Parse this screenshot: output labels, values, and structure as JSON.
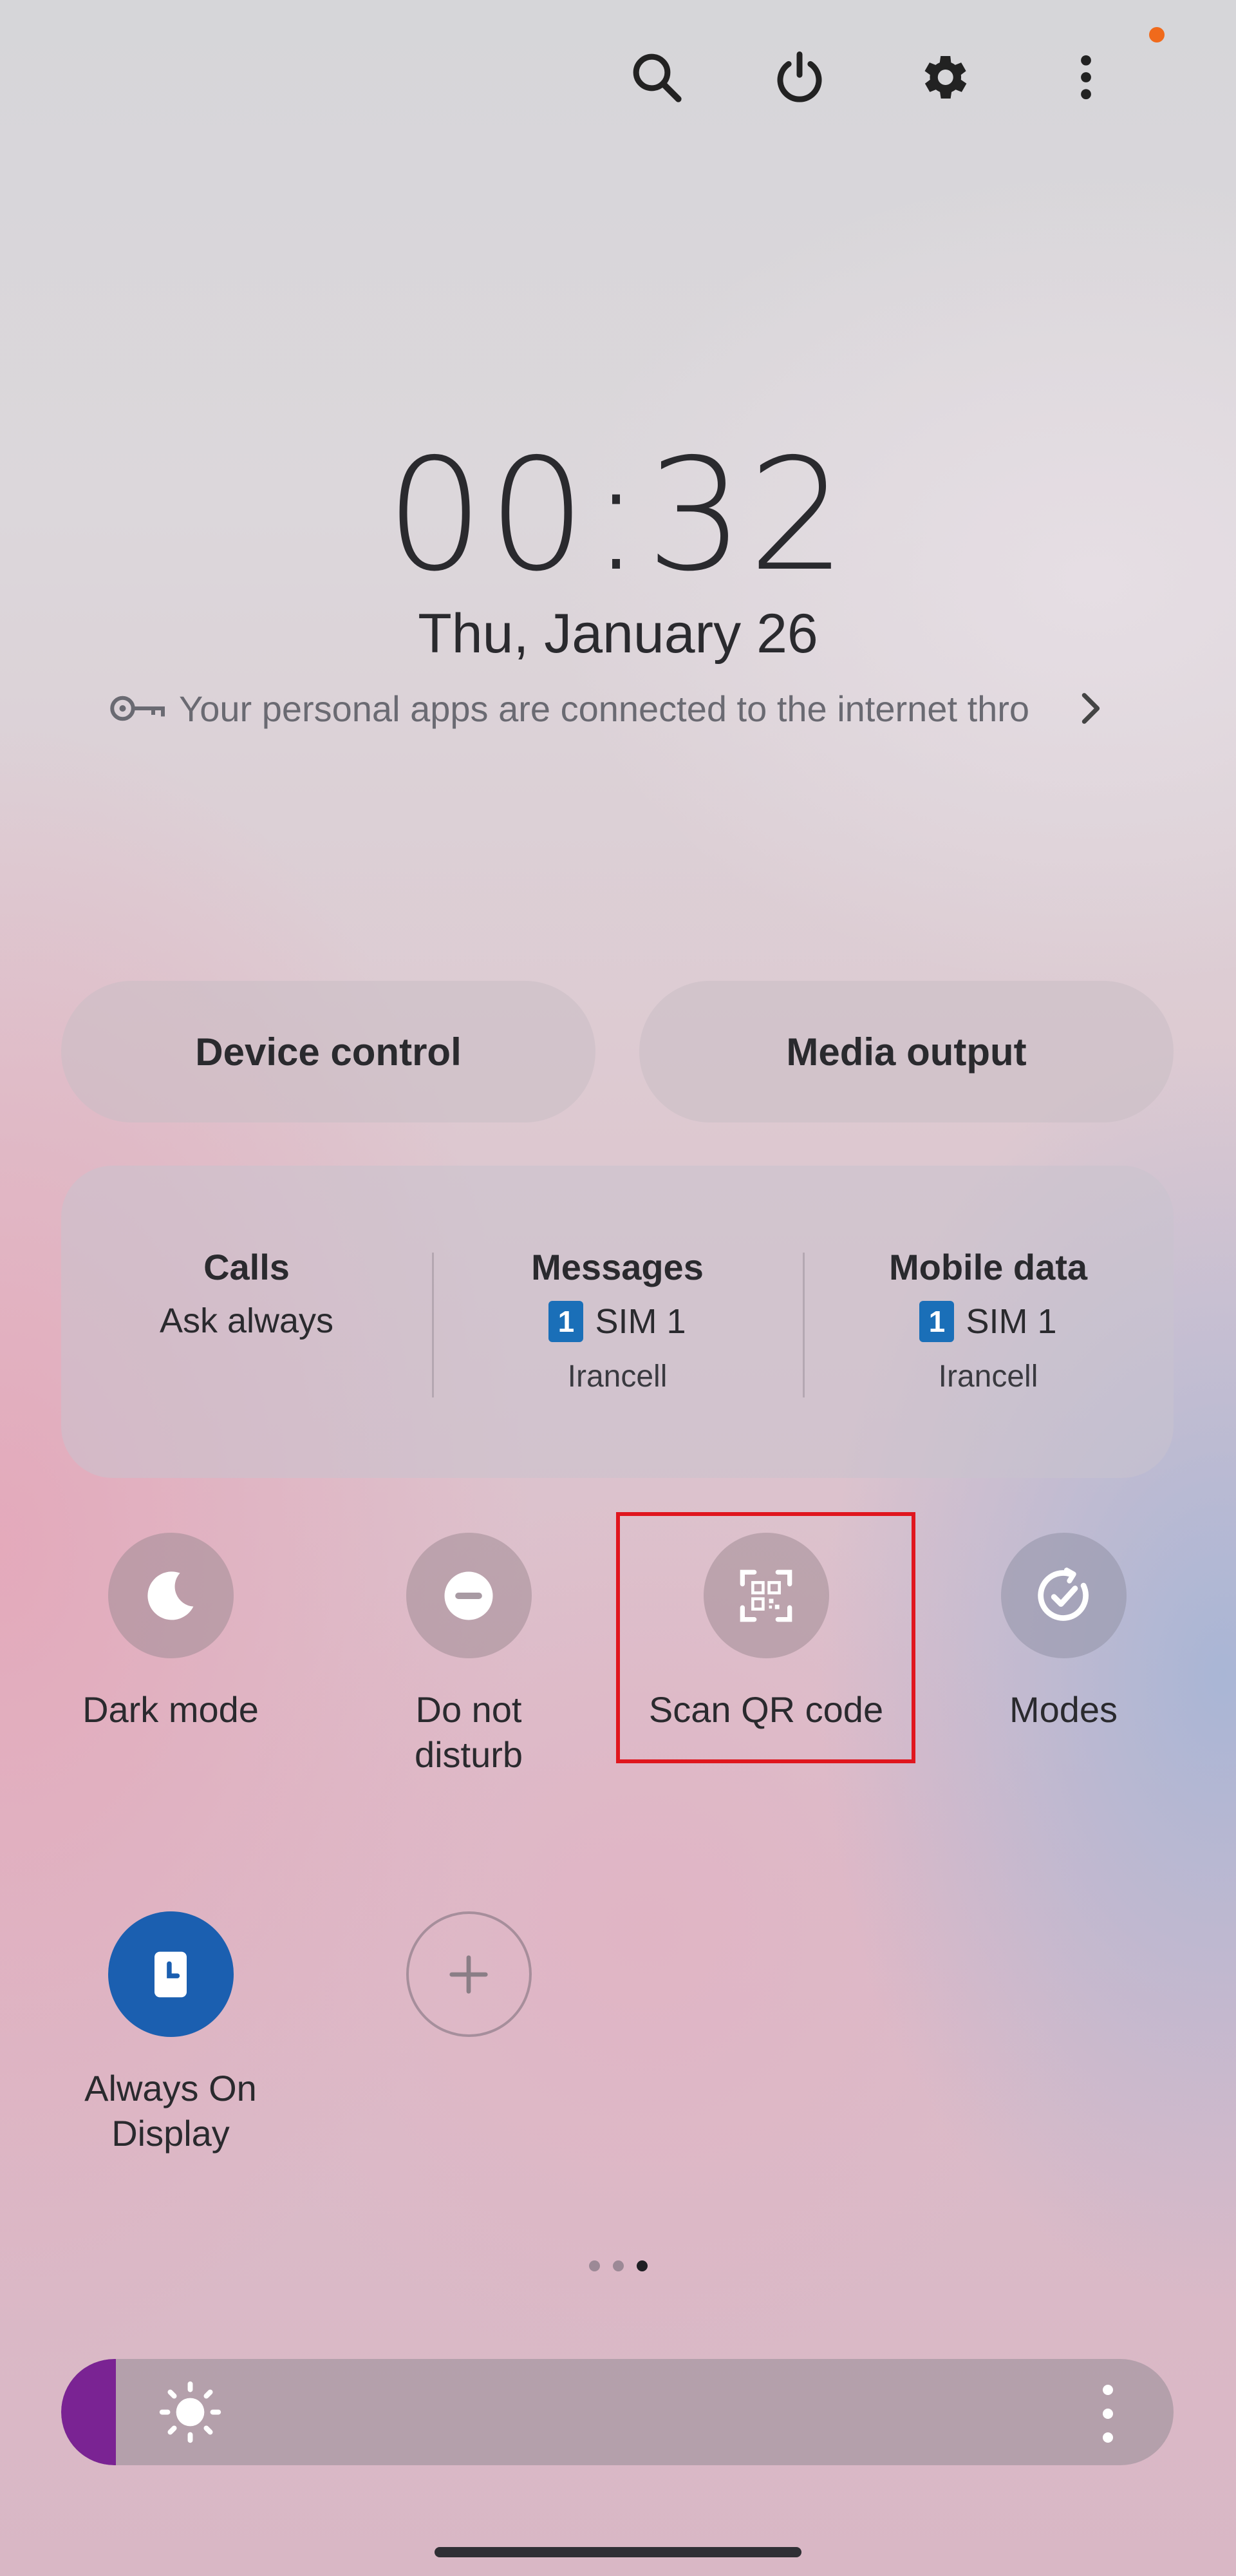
{
  "top_icons": [
    "search-icon",
    "power-icon",
    "gear-icon",
    "more-icon"
  ],
  "clock": {
    "time": "00:32",
    "date": "Thu, January 26"
  },
  "notice": {
    "text": "Your personal apps are connected to the internet thro"
  },
  "buttons": {
    "device_control": "Device control",
    "media_output": "Media output"
  },
  "sim": {
    "calls": {
      "title": "Calls",
      "value": "Ask always"
    },
    "messages": {
      "title": "Messages",
      "badge": "1",
      "value": "SIM 1",
      "carrier": "Irancell"
    },
    "mobile_data": {
      "title": "Mobile data",
      "badge": "1",
      "value": "SIM 1",
      "carrier": "Irancell"
    }
  },
  "tiles": {
    "dark_mode": "Dark mode",
    "do_not_disturb": "Do not\ndisturb",
    "scan_qr": "Scan QR code",
    "modes": "Modes",
    "always_on": "Always On\nDisplay"
  },
  "pager": {
    "count": 3,
    "active": 3
  },
  "brightness": {
    "level": 0.02
  },
  "colors": {
    "accent": "#7a2393",
    "aod": "#1b5fb0",
    "highlight": "#e0161e",
    "notification_dot": "#f06a1b"
  }
}
